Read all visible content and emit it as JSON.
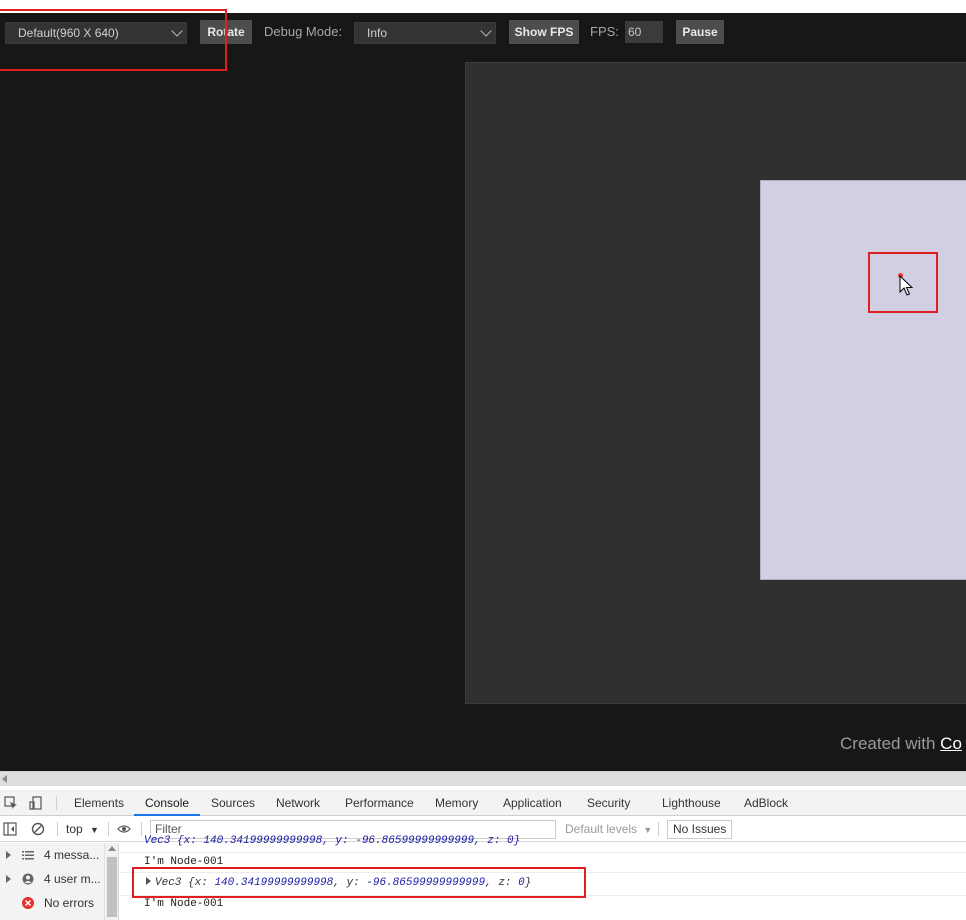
{
  "toolbar": {
    "resolution_select": "Default(960 X 640)",
    "rotate_label": "Rotate",
    "debug_mode_label": "Debug Mode:",
    "debug_mode_select": "Info",
    "show_fps_label": "Show FPS",
    "fps_label": "FPS:",
    "fps_value": "60",
    "pause_label": "Pause"
  },
  "footer": {
    "created_with": "Created with",
    "brand_partial": "Co"
  },
  "devtools": {
    "tabs": [
      "Elements",
      "Console",
      "Sources",
      "Network",
      "Performance",
      "Memory",
      "Application",
      "Security",
      "Lighthouse",
      "AdBlock"
    ],
    "active_tab": "Console",
    "context": "top",
    "filter_placeholder": "Filter",
    "levels_label": "Default levels",
    "issues_label": "No Issues",
    "sidebar": {
      "messages": "4 messa...",
      "user_messages": "4 user m...",
      "errors": "No errors"
    },
    "console": {
      "line1_cut": "Vec3 {x: 140.34199999999998, y: -96.86599999999999, z: 0}",
      "line2": "I'm Node-001",
      "line3_type": "Vec3",
      "line3_x_key": "x: ",
      "line3_x": "140.34199999999998",
      "line3_y_key": "y: ",
      "line3_y": "-96.86599999999999",
      "line3_z_key": "z: ",
      "line3_z": "0",
      "line4": "I'm Node-001"
    }
  },
  "colors": {
    "page_bg": "#171717",
    "game_frame": "#303030",
    "scene_bg": "#d2cfe3",
    "annotation": "#e02020",
    "node_dot": "#ee3535",
    "active_tab_underline": "#1a73e8"
  }
}
